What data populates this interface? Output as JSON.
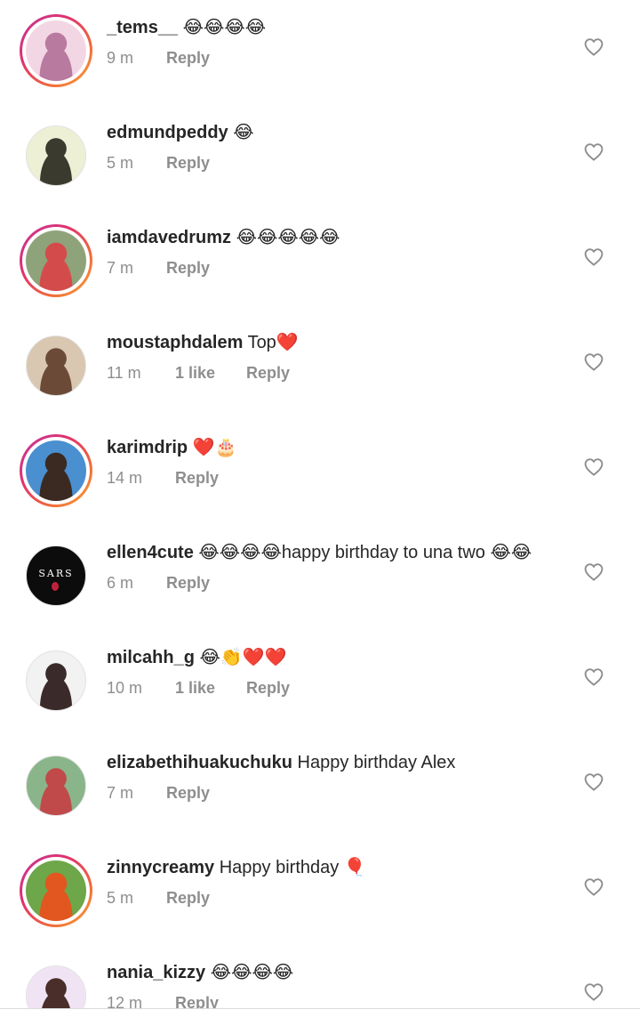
{
  "comments": [
    {
      "username": "_tems__",
      "text": "😂😂😂😂",
      "time": "9 m",
      "likes": "",
      "reply": "Reply",
      "story": true,
      "avatar_colors": [
        "#f3d6e4",
        "#b97aa0"
      ]
    },
    {
      "username": "edmundpeddy",
      "text": "😂",
      "time": "5 m",
      "likes": "",
      "reply": "Reply",
      "story": false,
      "avatar_colors": [
        "#eef0d6",
        "#3a3a2e"
      ]
    },
    {
      "username": "iamdavedrumz",
      "text": "😂😂😂😂😂",
      "time": "7 m",
      "likes": "",
      "reply": "Reply",
      "story": true,
      "avatar_colors": [
        "#8fa37a",
        "#d44b4b"
      ]
    },
    {
      "username": "moustaphdalem",
      "text": "Top❤️",
      "time": "11 m",
      "likes": "1 like",
      "reply": "Reply",
      "story": false,
      "avatar_colors": [
        "#d9c7b2",
        "#6b4a37"
      ]
    },
    {
      "username": "karimdrip",
      "text": "❤️🎂",
      "time": "14 m",
      "likes": "",
      "reply": "Reply",
      "story": true,
      "avatar_colors": [
        "#4a8fd0",
        "#3a2a22"
      ]
    },
    {
      "username": "ellen4cute",
      "text": "😂😂😂😂happy birthday to una two 😂😂",
      "time": "6 m",
      "likes": "",
      "reply": "Reply",
      "story": false,
      "avatar_colors": [
        "#0c0c0c",
        "#c0223a"
      ],
      "avatar_text": "SARS"
    },
    {
      "username": "milcahh_g",
      "text": "😂👏❤️❤️",
      "time": "10 m",
      "likes": "1 like",
      "reply": "Reply",
      "story": false,
      "avatar_colors": [
        "#f2f2f2",
        "#3b2a2a"
      ]
    },
    {
      "username": "elizabethihuakuchuku",
      "text": "Happy birthday Alex",
      "time": "7 m",
      "likes": "",
      "reply": "Reply",
      "story": false,
      "avatar_colors": [
        "#8ab58a",
        "#c04a4a"
      ]
    },
    {
      "username": "zinnycreamy",
      "text": "Happy birthday 🎈",
      "time": "5 m",
      "likes": "",
      "reply": "Reply",
      "story": true,
      "avatar_colors": [
        "#6ea64a",
        "#e2561f"
      ]
    },
    {
      "username": "nania_kizzy",
      "text": "😂😂😂😂",
      "time": "12 m",
      "likes": "",
      "reply": "Reply",
      "story": false,
      "avatar_colors": [
        "#f0e4f4",
        "#4a2e2a"
      ]
    }
  ],
  "icons": {
    "like": "heart-outline-icon"
  },
  "colors": {
    "text": "#262626",
    "meta": "#8e8e8e",
    "story_ring_start": "#c2389c",
    "story_ring_end": "#f9a836"
  }
}
